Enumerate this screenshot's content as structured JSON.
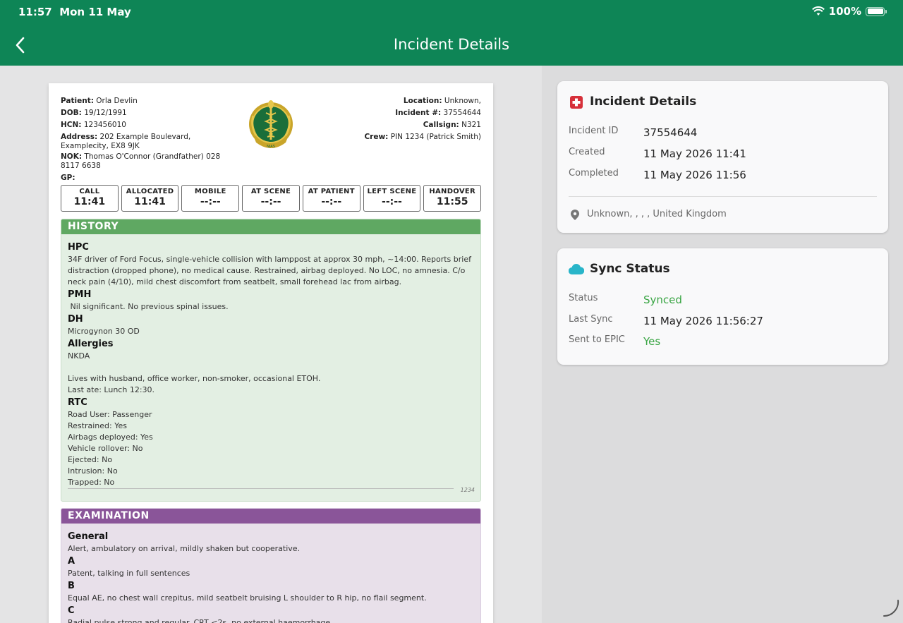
{
  "status_bar": {
    "time": "11:57",
    "date": "Mon 11 May",
    "battery": "100%"
  },
  "app_bar": {
    "title": "Incident Details"
  },
  "report": {
    "left_fields": [
      {
        "label": "Patient:",
        "value": "Orla Devlin"
      },
      {
        "label": "DOB:",
        "value": "19/12/1991"
      },
      {
        "label": "HCN:",
        "value": "123456010"
      },
      {
        "label": "Address:",
        "value": "202 Example Boulevard, Examplecity, EX8 9JK"
      },
      {
        "label": "NOK:",
        "value": "Thomas O'Connor (Grandfather) 028 8117 6638"
      },
      {
        "label": "GP:",
        "value": ""
      }
    ],
    "right_fields": [
      {
        "label": "Location:",
        "value": "Unknown,"
      },
      {
        "label": "Incident #:",
        "value": "37554644"
      },
      {
        "label": "Callsign:",
        "value": "N321"
      },
      {
        "label": "Crew:",
        "value": "PIN 1234 (Patrick Smith)"
      }
    ],
    "logo_text": "NIAS",
    "times": [
      {
        "label": "CALL",
        "value": "11:41"
      },
      {
        "label": "ALLOCATED",
        "value": "11:41"
      },
      {
        "label": "MOBILE",
        "value": "--:--"
      },
      {
        "label": "AT SCENE",
        "value": "--:--"
      },
      {
        "label": "AT PATIENT",
        "value": "--:--"
      },
      {
        "label": "LEFT SCENE",
        "value": "--:--"
      },
      {
        "label": "HANDOVER",
        "value": "11:55"
      }
    ],
    "history": {
      "title": "HISTORY",
      "hpc_heading": "HPC",
      "hpc_text": "34F driver of Ford Focus, single-vehicle collision with lamppost at approx 30 mph, ~14:00. Reports brief distraction (dropped phone), no medical cause. Restrained, airbag deployed. No LOC, no amnesia. C/o neck pain (4/10), mild chest discomfort from seatbelt, small forehead lac from airbag.",
      "pmh_heading": "PMH",
      "pmh_text": " Nil significant. No previous spinal issues.",
      "dh_heading": "DH",
      "dh_text": "Microgynon 30 OD",
      "allergies_heading": "Allergies",
      "allergies_text": "NKDA",
      "social_1": "Lives with husband, office worker, non-smoker, occasional ETOH.",
      "social_2": "Last ate: Lunch 12:30.",
      "rtc_heading": "RTC",
      "rtc_lines": [
        "Road User: Passenger",
        "Restrained: Yes",
        "Airbags deployed: Yes",
        "Vehicle rollover: No",
        "Ejected: No",
        "Intrusion: No",
        "Trapped: No"
      ],
      "signature_code": "1234"
    },
    "examination": {
      "title": "EXAMINATION",
      "general_heading": "General",
      "general_text": "Alert, ambulatory on arrival, mildly shaken but cooperative.",
      "a_heading": "A",
      "a_text": "Patent, talking in full sentences",
      "b_heading": "B",
      "b_text": "Equal AE, no chest wall crepitus, mild seatbelt bruising L shoulder to R hip, no flail segment.",
      "c_heading": "C",
      "c_text": "Radial pulse strong and regular. CRT <2s, no external haemorrhage."
    }
  },
  "incident_card": {
    "title": "Incident Details",
    "rows": [
      {
        "label": "Incident ID",
        "value": "37554644"
      },
      {
        "label": "Created",
        "value": "11 May 2026 11:41"
      },
      {
        "label": "Completed",
        "value": "11 May 2026 11:56"
      }
    ],
    "location": "Unknown, , , , United Kingdom"
  },
  "sync_card": {
    "title": "Sync Status",
    "rows": [
      {
        "label": "Status",
        "value": "Synced"
      },
      {
        "label": "Last Sync",
        "value": "11 May 2026 11:56:27"
      },
      {
        "label": "Sent to EPIC",
        "value": "Yes"
      }
    ]
  },
  "colors": {
    "app_bar": "#0e8556",
    "history": "#5fa862",
    "examination": "#8a5599",
    "success": "#3aa544",
    "incident_icon": "#d6303a",
    "cloud_icon": "#29b5c9"
  }
}
